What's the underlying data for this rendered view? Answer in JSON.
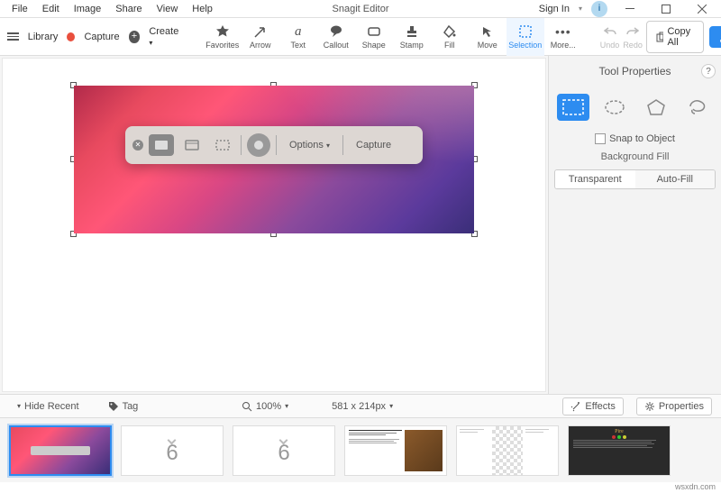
{
  "menu": {
    "items": [
      "File",
      "Edit",
      "Image",
      "Share",
      "View",
      "Help"
    ],
    "title": "Snagit Editor",
    "signin": "Sign In"
  },
  "toolbar": {
    "library": "Library",
    "capture": "Capture",
    "create": "Create",
    "tools": [
      "Favorites",
      "Arrow",
      "Text",
      "Callout",
      "Shape",
      "Stamp",
      "Fill",
      "Move",
      "Selection",
      "More..."
    ],
    "undo": "Undo",
    "redo": "Redo",
    "copyall": "Copy All",
    "share": "Share"
  },
  "canvas": {
    "capbar": {
      "options": "Options",
      "capture": "Capture"
    }
  },
  "props": {
    "title": "Tool Properties",
    "snap": "Snap to Object",
    "bgfill_label": "Background Fill",
    "seg": [
      "Transparent",
      "Auto-Fill"
    ]
  },
  "status": {
    "hide": "Hide Recent",
    "tag": "Tag",
    "zoom": "100%",
    "dims": "581 x 214px",
    "effects": "Effects",
    "properties": "Properties"
  },
  "footer": "wsxdn.com"
}
